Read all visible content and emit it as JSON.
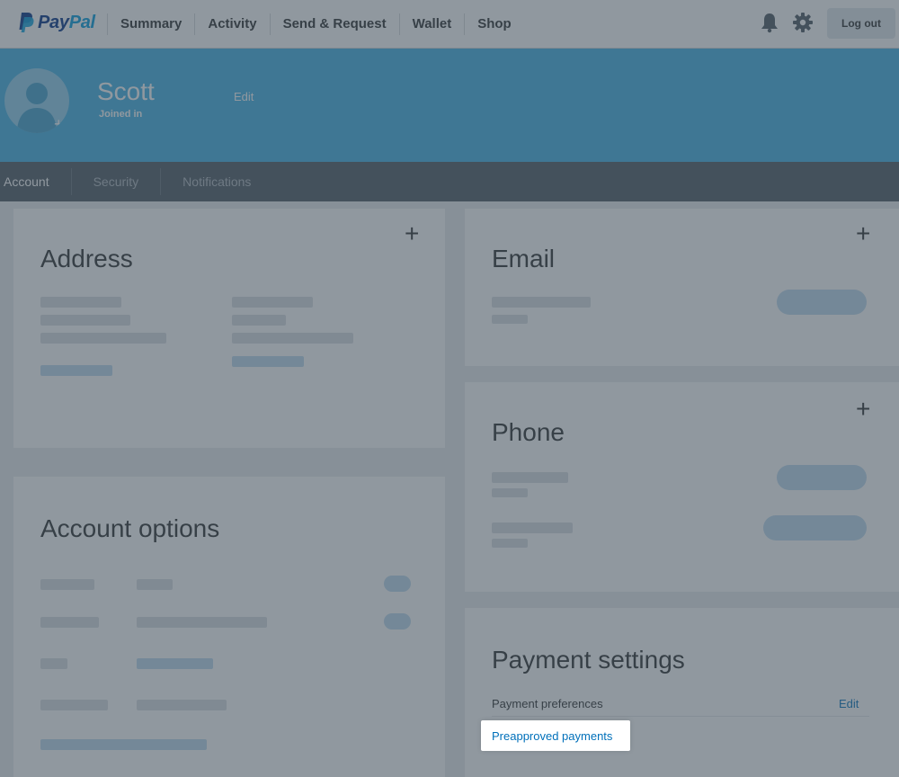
{
  "brand": {
    "pay": "Pay",
    "pal": "Pal"
  },
  "nav": {
    "items": [
      "Summary",
      "Activity",
      "Send & Request",
      "Wallet",
      "Shop"
    ],
    "logout_label": "Log out"
  },
  "profile": {
    "name": "Scott",
    "joined": "Joined in",
    "edit_label": "Edit",
    "avatar_plus": "+"
  },
  "subnav": {
    "tabs": [
      "Account",
      "Security",
      "Notifications"
    ]
  },
  "cards": {
    "address": {
      "title": "Address",
      "plus": "+"
    },
    "email": {
      "title": "Email",
      "plus": "+"
    },
    "phone": {
      "title": "Phone",
      "plus": "+"
    },
    "account_options": {
      "title": "Account options"
    },
    "payment_settings": {
      "title": "Payment settings",
      "preferences_label": "Payment preferences",
      "edit_label": "Edit",
      "preapproved_label": "Preapproved payments"
    }
  },
  "colors": {
    "accent_blue": "#3fb0e4",
    "link_blue": "#0070ba",
    "subnav_bg": "#4b5761"
  }
}
